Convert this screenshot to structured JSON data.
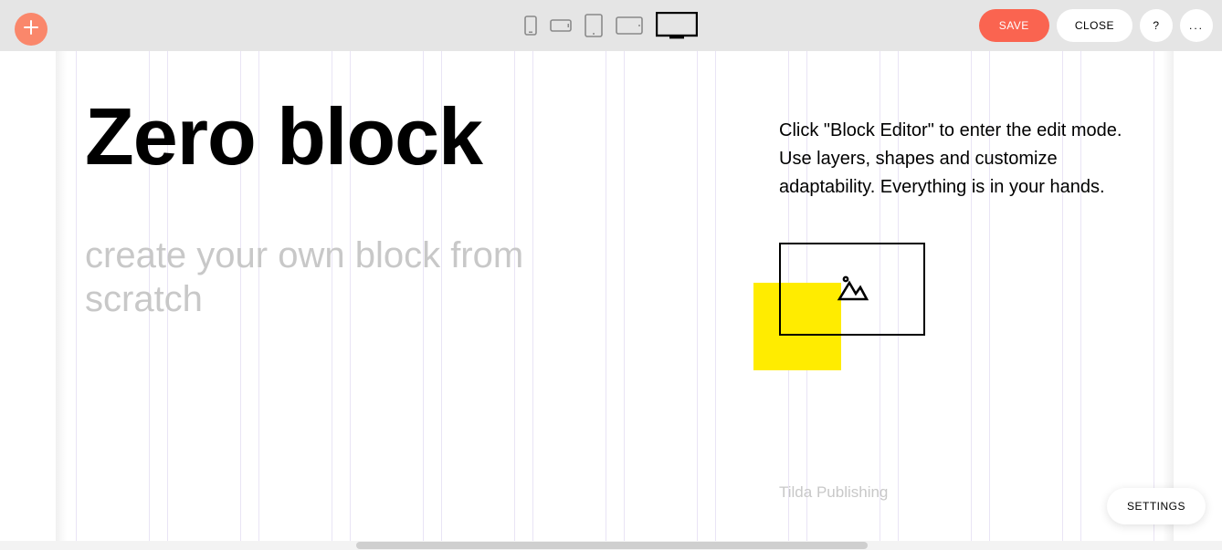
{
  "toolbar": {
    "save_label": "SAVE",
    "close_label": "CLOSE",
    "help_label": "?",
    "more_label": "...",
    "devices": [
      "phone-portrait",
      "phone-landscape",
      "tablet-portrait",
      "tablet-landscape",
      "desktop"
    ],
    "active_device": "desktop"
  },
  "canvas": {
    "title": "Zero block",
    "subtitle": "create your own block from scratch",
    "description": "Click \"Block Editor\" to enter the edit mode. Use layers, shapes and customize adaptability. Everything is in your hands.",
    "credit": "Tilda Publishing",
    "shapes": {
      "yellow_square_color": "#ffec00"
    }
  },
  "floating": {
    "settings_label": "SETTINGS"
  }
}
